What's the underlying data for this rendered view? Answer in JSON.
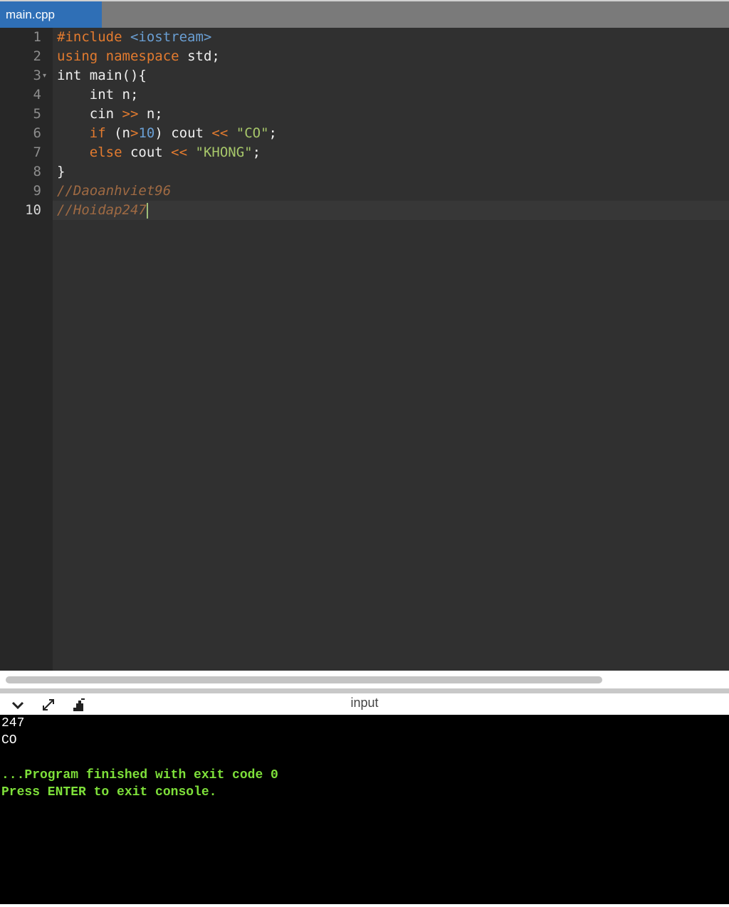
{
  "tab": {
    "label": "main.cpp"
  },
  "editor": {
    "line_numbers": [
      "1",
      "2",
      "3",
      "4",
      "5",
      "6",
      "7",
      "8",
      "9",
      "10"
    ],
    "code": {
      "l1_kw": "#include",
      "l1_lib": "<iostream>",
      "l2_kw1": "using",
      "l2_kw2": "namespace",
      "l2_rest": "std;",
      "l3": "int main(){",
      "l4": "    int n;",
      "l5_a": "    cin ",
      "l5_op": ">>",
      "l5_b": " n;",
      "l6_kw": "if",
      "l6_a": " (n",
      "l6_op1": ">",
      "l6_num": "10",
      "l6_b": ") cout ",
      "l6_op2": "<<",
      "l6_c": " ",
      "l6_str": "\"CO\"",
      "l6_d": ";",
      "l7_kw": "else",
      "l7_a": " cout ",
      "l7_op": "<<",
      "l7_b": " ",
      "l7_str": "\"KHONG\"",
      "l7_c": ";",
      "l8": "}",
      "l9": "//Daoanhviet96",
      "l10": "//Hoidap247"
    }
  },
  "console": {
    "title": "input",
    "icons": [
      "chevron-down-icon",
      "expand-icon",
      "clear-console-icon"
    ],
    "lines": [
      "247",
      "CO",
      "",
      "...Program finished with exit code 0",
      "Press ENTER to exit console."
    ]
  },
  "colors": {
    "keyword": "#e37b2f",
    "include": "#6a9fd4",
    "string": "#a7c76a",
    "comment": "#9f6a43",
    "console_green": "#7ee03a",
    "tab_blue": "#2f6fb6"
  }
}
